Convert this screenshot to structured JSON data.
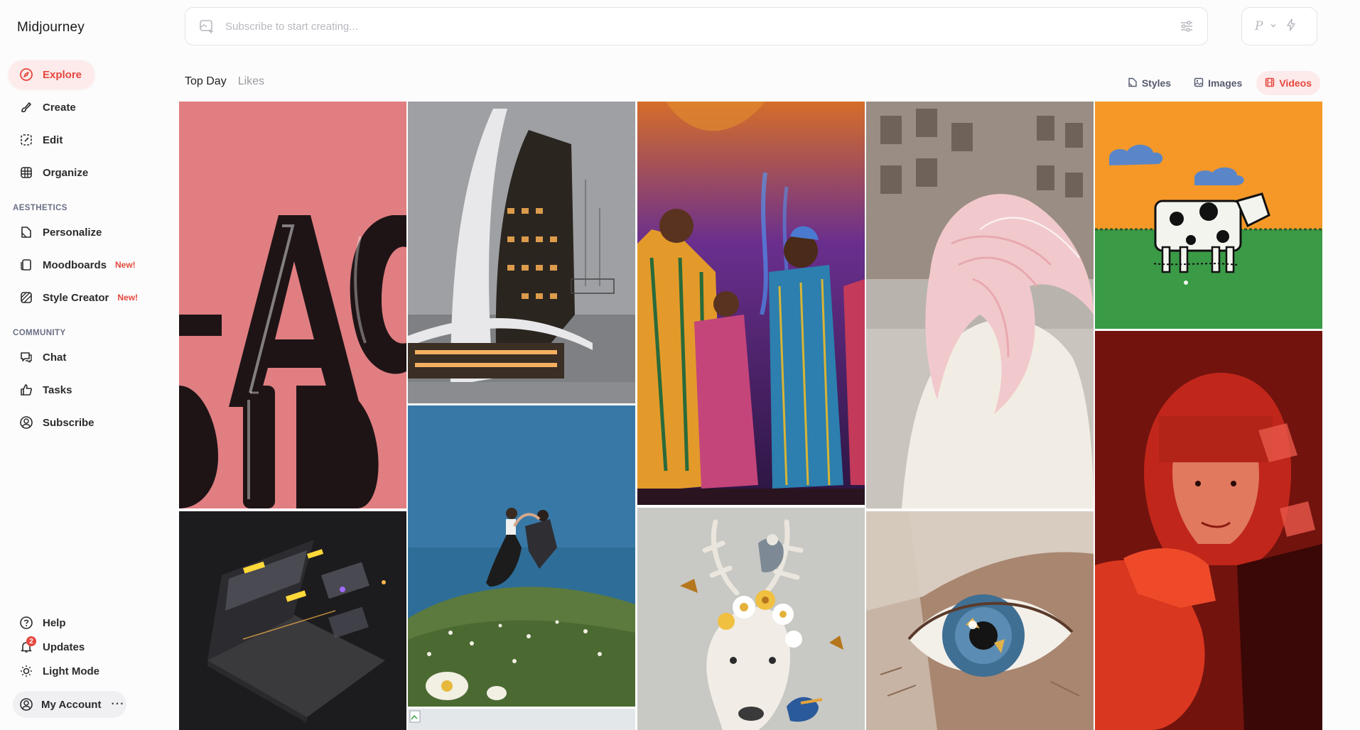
{
  "app": {
    "name": "Midjourney"
  },
  "sidebar": {
    "items": [
      {
        "label": "Explore",
        "icon": "compass-icon",
        "active": true
      },
      {
        "label": "Create",
        "icon": "brush-icon"
      },
      {
        "label": "Edit",
        "icon": "edit-icon"
      },
      {
        "label": "Organize",
        "icon": "grid-icon"
      }
    ],
    "aesthetics_label": "AESTHETICS",
    "aesthetics": [
      {
        "label": "Personalize",
        "icon": "personalize-icon"
      },
      {
        "label": "Moodboards",
        "icon": "moodboard-icon",
        "tag": "New!"
      },
      {
        "label": "Style Creator",
        "icon": "style-creator-icon",
        "tag": "New!"
      }
    ],
    "community_label": "COMMUNITY",
    "community": [
      {
        "label": "Chat",
        "icon": "chat-icon"
      },
      {
        "label": "Tasks",
        "icon": "thumbs-up-icon"
      },
      {
        "label": "Subscribe",
        "icon": "subscribe-icon"
      }
    ],
    "footer": [
      {
        "label": "Help",
        "icon": "help-icon"
      },
      {
        "label": "Updates",
        "icon": "bell-icon",
        "badge": "2"
      },
      {
        "label": "Light Mode",
        "icon": "sun-icon"
      }
    ],
    "account": {
      "label": "My Account",
      "more": "···"
    }
  },
  "prompt": {
    "placeholder": "Subscribe to start creating..."
  },
  "mode": {
    "label": "P"
  },
  "tabs": [
    {
      "label": "Top Day",
      "active": true
    },
    {
      "label": "Likes",
      "active": false
    }
  ],
  "filters": [
    {
      "label": "Styles",
      "icon": "styles-icon",
      "active": false
    },
    {
      "label": "Images",
      "icon": "image-icon",
      "active": false
    },
    {
      "label": "Videos",
      "icon": "video-icon",
      "active": true
    }
  ],
  "colors": {
    "accent": "#e5473e",
    "accent_bg": "#fdeaea"
  },
  "gallery": [
    {
      "name": "balloon-letters-image"
    },
    {
      "name": "futuristic-building-image"
    },
    {
      "name": "choir-performers-image"
    },
    {
      "name": "pink-hair-woman-image"
    },
    {
      "name": "pixel-cow-image"
    },
    {
      "name": "laptop-holograms-image"
    },
    {
      "name": "dancing-couple-image"
    },
    {
      "name": "deer-flowers-image"
    },
    {
      "name": "eye-closeup-image"
    },
    {
      "name": "red-portrait-image"
    },
    {
      "name": "broken-image"
    }
  ]
}
